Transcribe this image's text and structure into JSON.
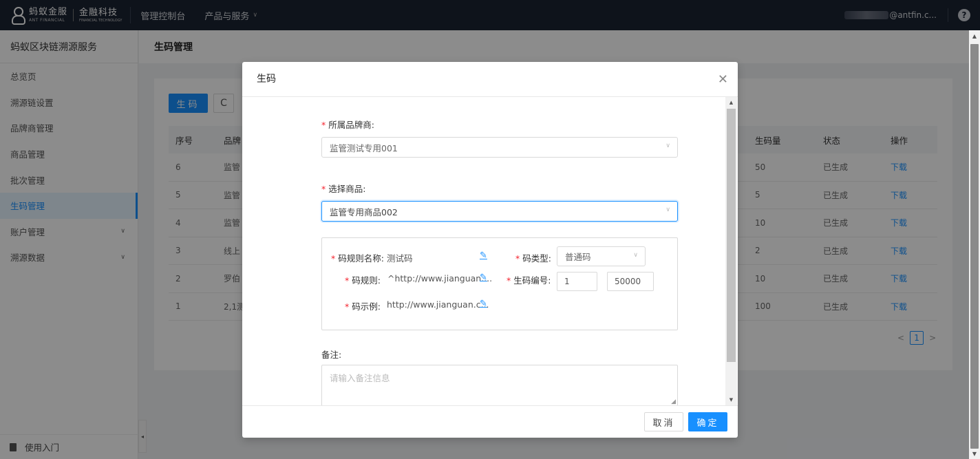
{
  "topbar": {
    "logo_ant": "蚂蚁金服",
    "logo_ant_sub": "ANT FINANCIAL",
    "logo_fin": "金融科技",
    "logo_fin_sub": "FINANCIAL TECHNOLOGY",
    "console": "管理控制台",
    "products": "产品与服务",
    "user_email": "@antfin.c...",
    "help": "?"
  },
  "sidebar": {
    "title": "蚂蚁区块链溯源服务",
    "items": [
      {
        "label": "总览页"
      },
      {
        "label": "溯源链设置"
      },
      {
        "label": "品牌商管理"
      },
      {
        "label": "商品管理"
      },
      {
        "label": "批次管理"
      },
      {
        "label": "生码管理"
      },
      {
        "label": "账户管理"
      },
      {
        "label": "溯源数据"
      }
    ],
    "footer": "使用入门"
  },
  "page": {
    "title": "生码管理",
    "gen_button": "生码",
    "refresh_icon": "C"
  },
  "table": {
    "headers": [
      "序号",
      "品牌",
      "生码量",
      "状态",
      "操作"
    ],
    "rows": [
      {
        "idx": "6",
        "brand": "监管",
        "qty": "50",
        "status": "已生成",
        "action": "下载"
      },
      {
        "idx": "5",
        "brand": "监管",
        "qty": "5",
        "status": "已生成",
        "action": "下载"
      },
      {
        "idx": "4",
        "brand": "监管",
        "qty": "10",
        "status": "已生成",
        "action": "下载"
      },
      {
        "idx": "3",
        "brand": "线上",
        "qty": "2",
        "status": "已生成",
        "action": "下载"
      },
      {
        "idx": "2",
        "brand": "罗伯",
        "qty": "10",
        "status": "已生成",
        "action": "下载"
      },
      {
        "idx": "1",
        "brand": "2,1测",
        "qty": "100",
        "status": "已生成",
        "action": "下载"
      }
    ],
    "page_num": "1"
  },
  "modal": {
    "title": "生码",
    "brand_label": "所属品牌商:",
    "brand_value": "监管测试专用001",
    "product_label": "选择商品:",
    "product_value": "监管专用商品002",
    "rule_name_label": "码规则名称:",
    "rule_name_value": "测试码",
    "code_type_label": "码类型:",
    "code_type_value": "普通码",
    "rule_label": "码规则:",
    "rule_value": "^http://www.jianguan....",
    "serial_label": "生码编号:",
    "serial_from": "1",
    "serial_to": "50000",
    "example_label": "码示例:",
    "example_value": "http://www.jianguan.c...",
    "remark_label": "备注:",
    "remark_placeholder": "请输入备注信息",
    "cancel": "取消",
    "ok": "确定"
  }
}
